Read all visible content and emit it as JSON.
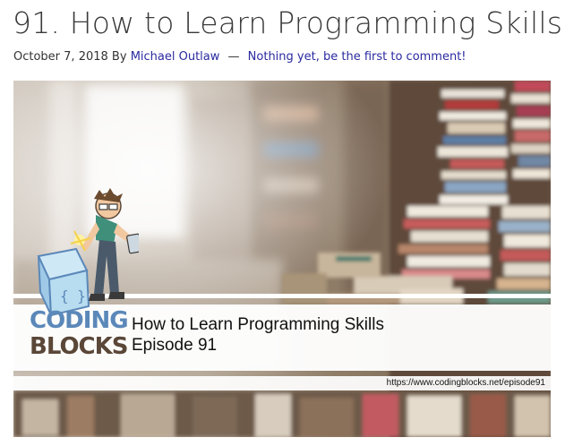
{
  "post": {
    "title": "91. How to Learn Programming Skills",
    "date": "October 7, 2018",
    "by_label": "By",
    "author": "Michael Outlaw",
    "separator": "—",
    "comments": "Nothing yet, be the first to comment!"
  },
  "hero": {
    "logo_line1": "CODING",
    "logo_line2": "BLOCKS",
    "episode_title": "How to Learn Programming Skills",
    "episode_number": "Episode 91",
    "url": "https://www.codingblocks.net/episode91"
  },
  "colors": {
    "link": "#2a2aa0",
    "logo_blue": "#5b88b9",
    "logo_dark": "#5a4738"
  }
}
